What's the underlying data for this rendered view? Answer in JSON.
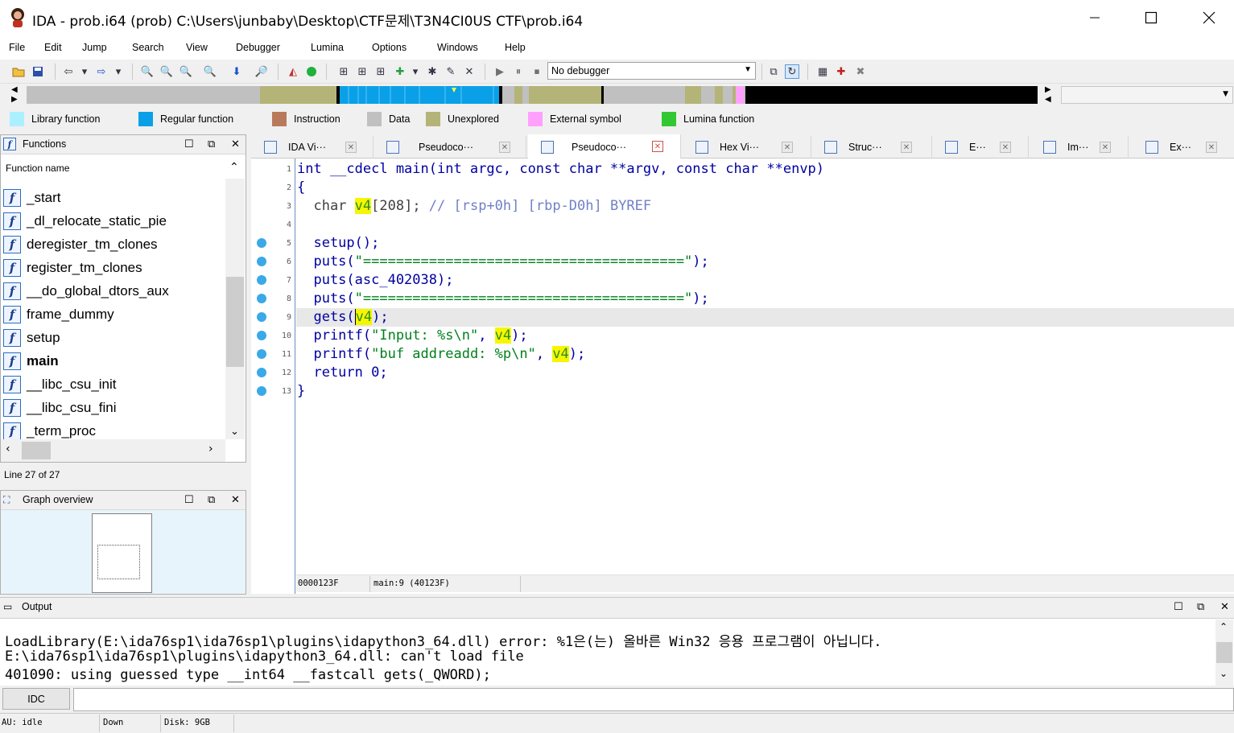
{
  "window": {
    "title": "IDA - prob.i64 (prob) C:\\Users\\junbaby\\Desktop\\CTF문제\\T3N4CI0US CTF\\prob.i64",
    "minimize": "—",
    "maximize": "☐",
    "close": "✕"
  },
  "menu": [
    "File",
    "Edit",
    "Jump",
    "Search",
    "View",
    "Debugger",
    "Lumina",
    "Options",
    "Windows",
    "Help"
  ],
  "toolbar": {
    "debugger_select": "No debugger"
  },
  "legend": [
    {
      "label": "Library function",
      "color": "#aaf0ff"
    },
    {
      "label": "Regular function",
      "color": "#0aa0e8"
    },
    {
      "label": "Instruction",
      "color": "#b87a5a"
    },
    {
      "label": "Data",
      "color": "#c0c0c0"
    },
    {
      "label": "Unexplored",
      "color": "#b4b478"
    },
    {
      "label": "External symbol",
      "color": "#ffa0ff"
    },
    {
      "label": "Lumina function",
      "color": "#32c832"
    }
  ],
  "functions_panel": {
    "title": "Functions",
    "column_header": "Function name",
    "items": [
      "_start",
      "_dl_relocate_static_pie",
      "deregister_tm_clones",
      "register_tm_clones",
      "__do_global_dtors_aux",
      "frame_dummy",
      "setup",
      "main",
      "__libc_csu_init",
      "__libc_csu_fini",
      "_term_proc"
    ],
    "selected": "main",
    "line_count": "Line 27 of 27"
  },
  "graph_panel": {
    "title": "Graph overview"
  },
  "tabs": [
    {
      "label": "IDA Vi···"
    },
    {
      "label": "Pseudoco···"
    },
    {
      "label": "Pseudoco···",
      "active": true
    },
    {
      "label": "Hex Vi···"
    },
    {
      "label": "Struc···"
    },
    {
      "label": "E···"
    },
    {
      "label": "Im···"
    },
    {
      "label": "Ex···"
    }
  ],
  "code": {
    "line_numbers": [
      "1",
      "2",
      "3",
      "4",
      "5",
      "6",
      "7",
      "8",
      "9",
      "10",
      "11",
      "12",
      "13"
    ],
    "l1": "int __cdecl main(int argc, const char **argv, const char **envp)",
    "l2": "{",
    "l3_a": "  char ",
    "l3_var": "v4",
    "l3_b": "[208]; ",
    "l3_cm": "// [rsp+0h] [rbp-D0h] BYREF",
    "l5": "  setup();",
    "l6_a": "  puts(",
    "l6_s": "\"=======================================\"",
    "l6_b": ");",
    "l7": "  puts(asc_402038);",
    "l8_a": "  puts(",
    "l8_s": "\"=======================================\"",
    "l8_b": ");",
    "l9_a": "  gets(",
    "l9_var": "v4",
    "l9_b": ");",
    "l10_a": "  printf(",
    "l10_s": "\"Input: %s\\n\"",
    "l10_b": ", ",
    "l10_var": "v4",
    "l10_c": ");",
    "l11_a": "  printf(",
    "l11_s": "\"buf addreadd: %p\\n\"",
    "l11_b": ", ",
    "l11_var": "v4",
    "l11_c": ");",
    "l12": "  return 0;",
    "l13": "}",
    "status_addr": "0000123F",
    "status_loc": "main:9 (40123F)"
  },
  "output": {
    "title": "Output",
    "lines": [
      "LoadLibrary(E:\\ida76sp1\\ida76sp1\\plugins\\idapython3_64.dll) error: %1은(는) 올바른 Win32 응용 프로그램이 아닙니다.",
      "E:\\ida76sp1\\ida76sp1\\plugins\\idapython3_64.dll: can't load file",
      "401090: using guessed type __int64 __fastcall gets(_QWORD);"
    ],
    "idc_button": "IDC"
  },
  "statusbar": {
    "au": "AU:  idle",
    "dir": "Down",
    "disk": "Disk: 9GB"
  }
}
